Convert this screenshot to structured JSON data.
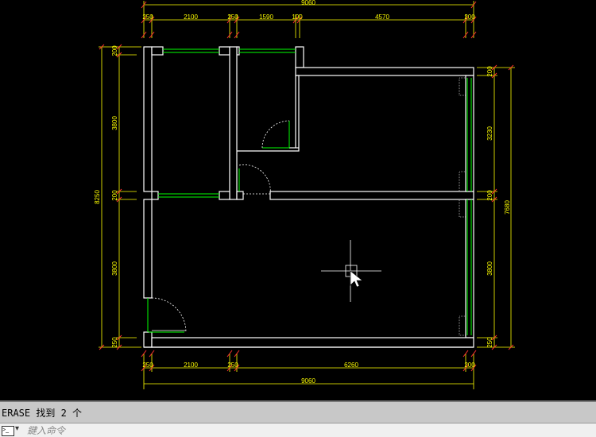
{
  "drawing": {
    "top_total": "9060",
    "top_dims": [
      "250",
      "2100",
      "250",
      "1590",
      "100",
      "4570",
      "200"
    ],
    "bottom_dims": [
      "250",
      "2100",
      "250",
      "6260",
      "200"
    ],
    "bottom_total": "9060",
    "left_dims": [
      "200",
      "3800",
      "200",
      "3800",
      "250"
    ],
    "left_total": "8250",
    "right_dims": [
      "200",
      "3230",
      "200",
      "3800",
      "250"
    ],
    "right_total": "7680"
  },
  "command": {
    "history": "ERASE  找到 2 个",
    "placeholder": "鍵入命令",
    "icon_text": ">_"
  },
  "colors": {
    "background": "#000000",
    "dimension": "#ffff00",
    "wall": "#ffffff",
    "window": "#00ff00",
    "extension_tick": "#ff3030"
  }
}
